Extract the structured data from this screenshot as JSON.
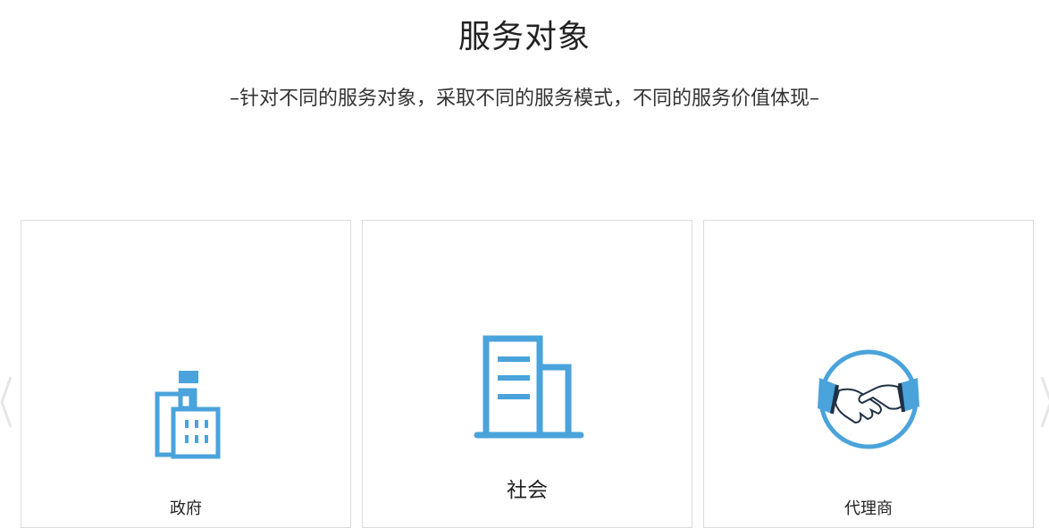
{
  "section": {
    "title": "服务对象",
    "subtitle": "–针对不同的服务对象，采取不同的服务模式，不同的服务价值体现–"
  },
  "cards": [
    {
      "label": "政府",
      "icon": "government-building-icon"
    },
    {
      "label": "社会",
      "icon": "office-building-icon"
    },
    {
      "label": "代理商",
      "icon": "handshake-icon"
    }
  ],
  "colors": {
    "accent": "#4aa3db",
    "dark": "#1f3146",
    "border": "#dcdcdc"
  }
}
